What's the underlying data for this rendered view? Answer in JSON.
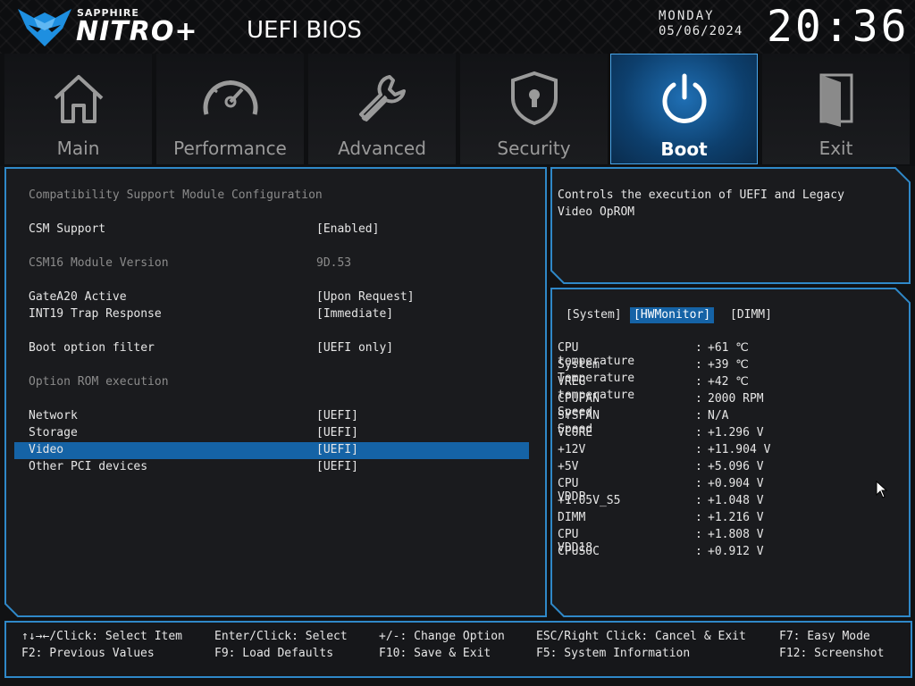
{
  "header": {
    "brand_small": "SAPPHIRE",
    "brand_big": "NITRO+",
    "title": "UEFI BIOS",
    "day": "MONDAY",
    "date": "05/06/2024",
    "clock": "20:36"
  },
  "nav": {
    "tabs": [
      {
        "label": "Main",
        "icon": "home-icon",
        "active": false
      },
      {
        "label": "Performance",
        "icon": "gauge-icon",
        "active": false
      },
      {
        "label": "Advanced",
        "icon": "wrench-icon",
        "active": false
      },
      {
        "label": "Security",
        "icon": "shield-lock-icon",
        "active": false
      },
      {
        "label": "Boot",
        "icon": "power-icon",
        "active": true
      },
      {
        "label": "Exit",
        "icon": "door-exit-icon",
        "active": false
      }
    ]
  },
  "main": {
    "section_title": "Compatibility Support Module Configuration",
    "csm_support": {
      "label": "CSM Support",
      "value": "[Enabled]"
    },
    "csm16_version": {
      "label": "CSM16 Module Version",
      "value": "9D.53"
    },
    "gatea20": {
      "label": "GateA20 Active",
      "value": "[Upon Request]"
    },
    "int19": {
      "label": "INT19 Trap Response",
      "value": "[Immediate]"
    },
    "boot_filter": {
      "label": "Boot option filter",
      "value": "[UEFI only]"
    },
    "option_rom_title": "Option ROM execution",
    "network": {
      "label": "Network",
      "value": "[UEFI]"
    },
    "storage": {
      "label": "Storage",
      "value": "[UEFI]"
    },
    "video": {
      "label": "Video",
      "value": "[UEFI]"
    },
    "other_pci": {
      "label": "Other PCI devices",
      "value": "[UEFI]"
    }
  },
  "help": {
    "line1": "Controls the execution of UEFI and Legacy",
    "line2": "Video OpROM"
  },
  "hwmon": {
    "tabs": {
      "system": "[System]",
      "hwmonitor": "[HWMonitor]",
      "dimm": "[DIMM]"
    },
    "readings": [
      {
        "name": "CPU temperature",
        "value": "+61 ℃"
      },
      {
        "name": "System Temperature",
        "value": "+39 ℃"
      },
      {
        "name": "VREG temperature",
        "value": "+42 ℃"
      },
      {
        "name": "CPUFAN Speed",
        "value": "2000 RPM"
      },
      {
        "name": "SYSFAN Speed",
        "value": "N/A"
      },
      {
        "name": "VCORE",
        "value": "+1.296 V"
      },
      {
        "name": "+12V",
        "value": "+11.904 V"
      },
      {
        "name": "+5V",
        "value": "+5.096 V"
      },
      {
        "name": "CPU VDDP",
        "value": "+0.904 V"
      },
      {
        "name": "+1.05V_S5",
        "value": "+1.048 V"
      },
      {
        "name": "DIMM",
        "value": "+1.216 V"
      },
      {
        "name": "CPU VDD18",
        "value": "+1.808 V"
      },
      {
        "name": "CPUSOC",
        "value": "+0.912 V"
      }
    ]
  },
  "footer": {
    "select_item": "↑↓→←/Click: Select Item",
    "prev_values": "F2: Previous Values",
    "enter_select": "Enter/Click: Select",
    "load_defaults": "F9: Load Defaults",
    "change_option": "+/-: Change Option",
    "save_exit": "F10: Save & Exit",
    "cancel_exit": "ESC/Right Click: Cancel & Exit",
    "sys_info": "F5: System Information",
    "easy_mode": "F7: Easy Mode",
    "screenshot": "F12: Screenshot"
  },
  "colors": {
    "accent": "#1563a6",
    "frame": "#2f88c8",
    "active_tab_border": "#4aa6ea"
  }
}
